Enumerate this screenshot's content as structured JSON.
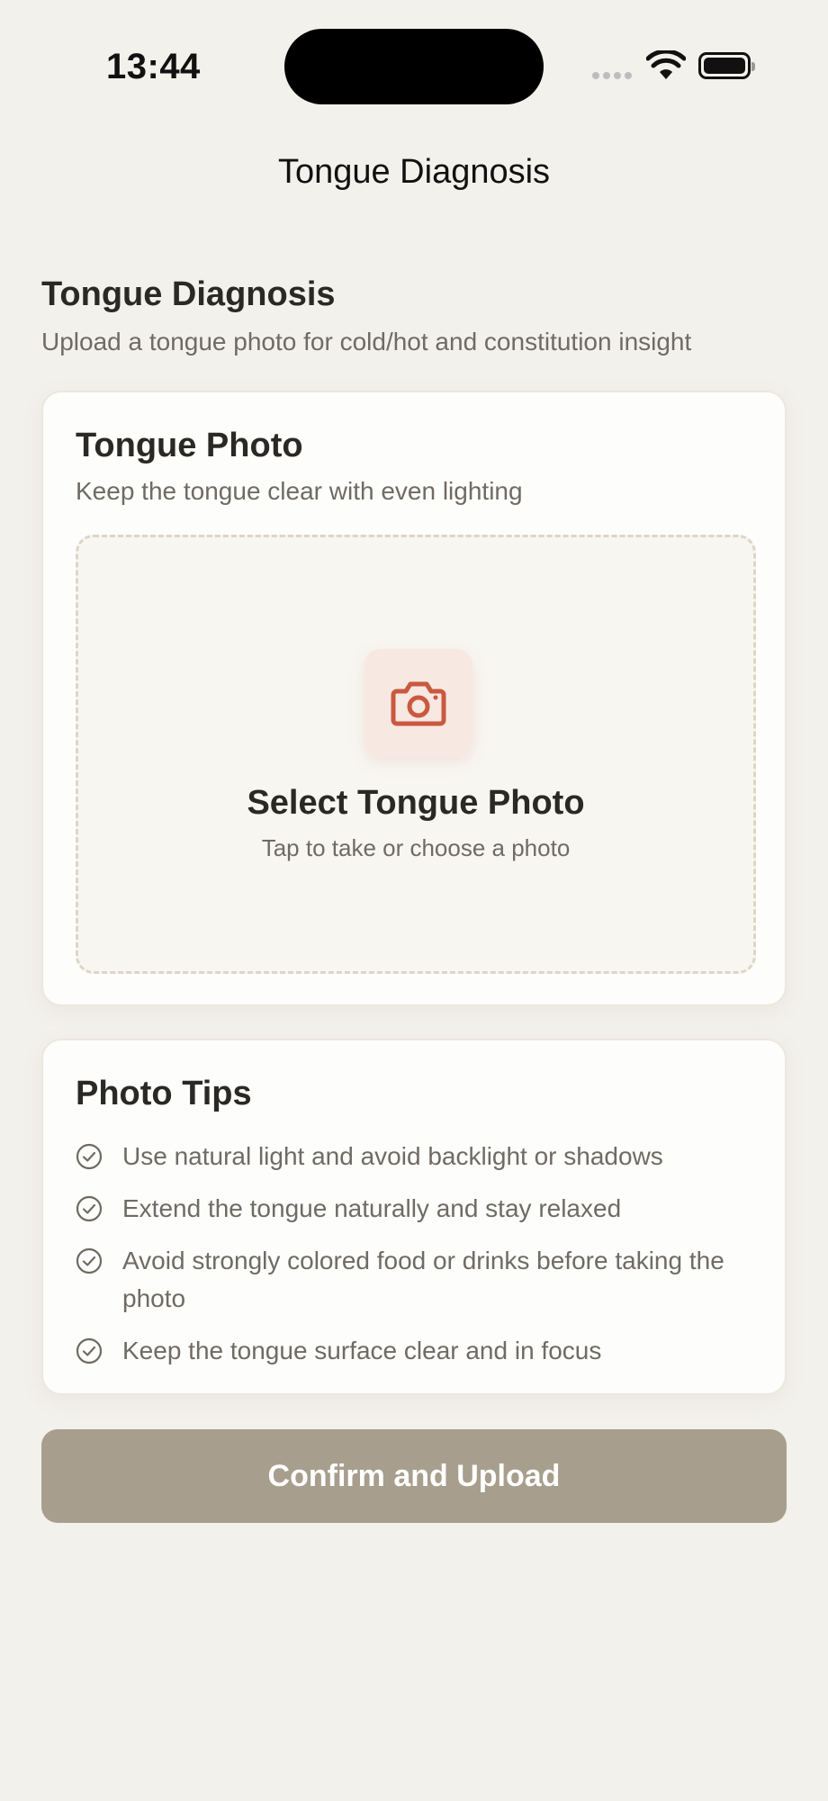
{
  "status_bar": {
    "time": "13:44"
  },
  "nav": {
    "title": "Tongue Diagnosis"
  },
  "page": {
    "heading": "Tongue Diagnosis",
    "subtitle": "Upload a tongue photo for cold/hot and constitution insight"
  },
  "photo_card": {
    "title": "Tongue Photo",
    "subtitle": "Keep the tongue clear with even lighting",
    "dropzone": {
      "icon": "camera-icon",
      "title": "Select Tongue Photo",
      "subtitle": "Tap to take or choose a photo"
    }
  },
  "tips_card": {
    "title": "Photo Tips",
    "items": [
      {
        "icon": "check-circle-icon",
        "text": "Use natural light and avoid backlight or shadows"
      },
      {
        "icon": "check-circle-icon",
        "text": "Extend the tongue naturally and stay relaxed"
      },
      {
        "icon": "check-circle-icon",
        "text": "Avoid strongly colored food or drinks before taking the photo"
      },
      {
        "icon": "check-circle-icon",
        "text": "Keep the tongue surface clear and in focus"
      }
    ]
  },
  "confirm_button": {
    "label": "Confirm and Upload",
    "state": "disabled"
  },
  "colors": {
    "background": "#f3f1eb",
    "card": "#fdfdfb",
    "accent": "#c9593f",
    "button_disabled": "#a89e8e",
    "text_primary": "#2b2926",
    "text_secondary": "#6f6b64"
  }
}
